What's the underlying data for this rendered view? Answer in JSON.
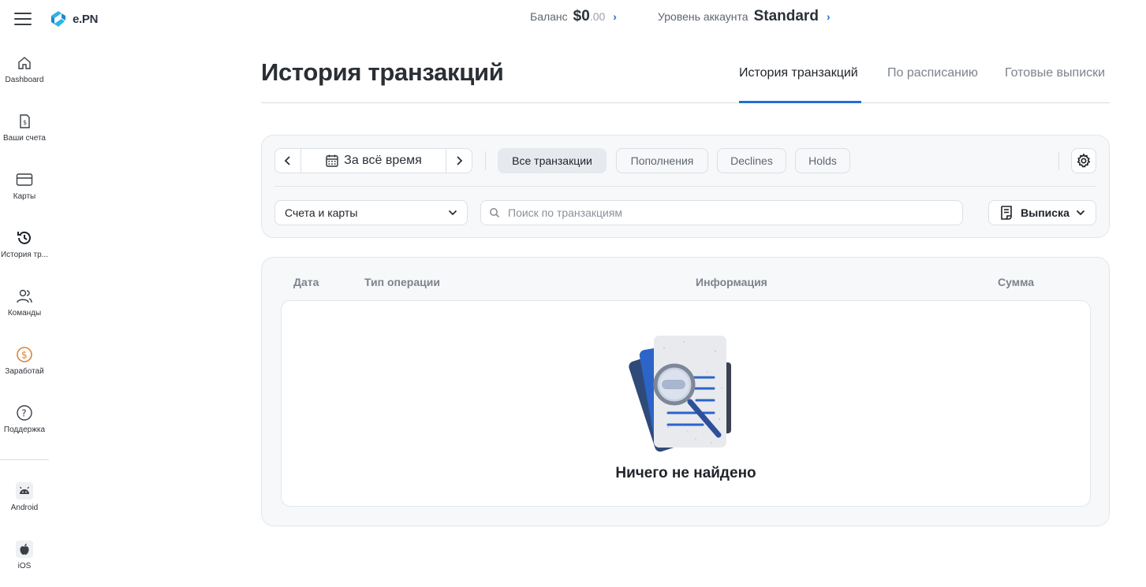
{
  "app": {
    "logo_text": "e.PN"
  },
  "topbar": {
    "balance_label": "Баланс",
    "balance_amount": "$0",
    "balance_cents": ".00",
    "account_level_label": "Уровень аккаунта",
    "account_level_value": "Standard"
  },
  "sidebar": {
    "items": [
      {
        "label": "Dashboard",
        "icon": "home-icon"
      },
      {
        "label": "Ваши счета",
        "icon": "invoice-icon"
      },
      {
        "label": "Карты",
        "icon": "card-icon"
      },
      {
        "label": "История тр...",
        "icon": "history-icon"
      },
      {
        "label": "Команды",
        "icon": "team-icon"
      },
      {
        "label": "Заработай",
        "icon": "dollar-coin-icon"
      },
      {
        "label": "Поддержка",
        "icon": "help-icon"
      }
    ],
    "apps": [
      {
        "label": "Android",
        "icon": "android-icon"
      },
      {
        "label": "iOS",
        "icon": "apple-icon"
      }
    ]
  },
  "page": {
    "title": "История транзакций",
    "tabs": [
      {
        "label": "История транзакций",
        "active": true
      },
      {
        "label": "По расписанию",
        "active": false
      },
      {
        "label": "Готовые выписки",
        "active": false
      }
    ]
  },
  "filters": {
    "date_range": "За всё время",
    "chips": [
      {
        "label": "Все транзакции",
        "active": true
      },
      {
        "label": "Пополнения",
        "active": false
      },
      {
        "label": "Declines",
        "active": false
      },
      {
        "label": "Holds",
        "active": false
      }
    ],
    "accounts_select": "Счета и карты",
    "search_placeholder": "Поиск по транзакциям",
    "export_label": "Выписка"
  },
  "table": {
    "columns": [
      "Дата",
      "Тип операции",
      "Информация",
      "Сумма"
    ],
    "empty_text": "Ничего не найдено"
  },
  "colors": {
    "accent": "#1f6fd6",
    "earn_icon": "#d9853b"
  }
}
